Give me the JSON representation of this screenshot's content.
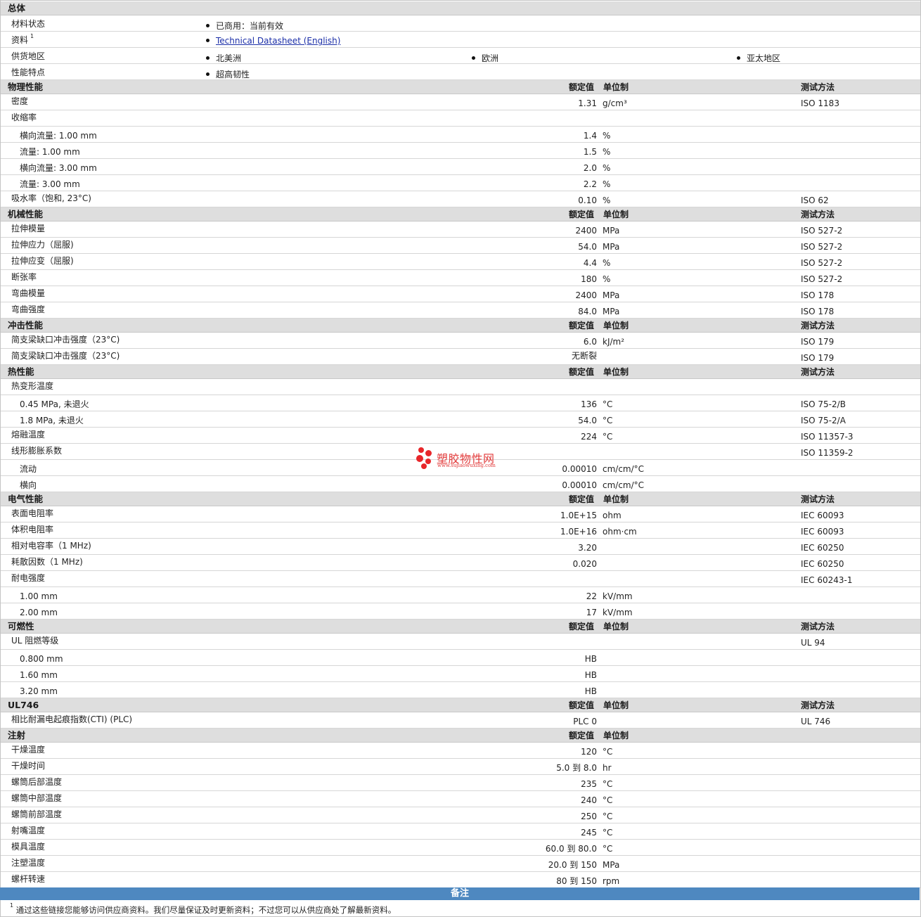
{
  "general": {
    "title": "总体",
    "rows": [
      {
        "label": "材料状态",
        "values": [
          "已商用：当前有效"
        ]
      },
      {
        "label": "资料",
        "sup": "1",
        "values": [
          "Technical Datasheet (English)"
        ],
        "link": true
      },
      {
        "label": "供货地区",
        "values": [
          "北美洲",
          "欧洲",
          "亚太地区"
        ]
      },
      {
        "label": "性能特点",
        "values": [
          "超高韧性"
        ]
      }
    ]
  },
  "col_headers": {
    "nominal": "额定值",
    "unit": "单位制",
    "method": "测试方法"
  },
  "sections": [
    {
      "title": "物理性能",
      "rows": [
        {
          "name": "密度",
          "value": "1.31",
          "unit": "g/cm³",
          "method": "ISO 1183"
        },
        {
          "name": "收缩率",
          "value": "",
          "unit": "",
          "method": ""
        },
        {
          "name": "横向流量: 1.00 mm",
          "value": "1.4",
          "unit": "%",
          "method": "",
          "sub": true
        },
        {
          "name": "流量: 1.00 mm",
          "value": "1.5",
          "unit": "%",
          "method": "",
          "sub": true
        },
        {
          "name": "横向流量: 3.00 mm",
          "value": "2.0",
          "unit": "%",
          "method": "",
          "sub": true
        },
        {
          "name": "流量: 3.00 mm",
          "value": "2.2",
          "unit": "%",
          "method": "",
          "sub": true
        },
        {
          "name": "吸水率（饱和, 23°C)",
          "value": "0.10",
          "unit": "%",
          "method": "ISO 62"
        }
      ]
    },
    {
      "title": "机械性能",
      "rows": [
        {
          "name": "拉伸模量",
          "value": "2400",
          "unit": "MPa",
          "method": "ISO 527-2"
        },
        {
          "name": "拉伸应力（屈服)",
          "value": "54.0",
          "unit": "MPa",
          "method": "ISO 527-2"
        },
        {
          "name": "拉伸应变（屈服)",
          "value": "4.4",
          "unit": "%",
          "method": "ISO 527-2"
        },
        {
          "name": "断张率",
          "value": "180",
          "unit": "%",
          "method": "ISO 527-2"
        },
        {
          "name": "弯曲模量",
          "value": "2400",
          "unit": "MPa",
          "method": "ISO 178"
        },
        {
          "name": "弯曲强度",
          "value": "84.0",
          "unit": "MPa",
          "method": "ISO 178"
        }
      ]
    },
    {
      "title": "冲击性能",
      "rows": [
        {
          "name": "简支梁缺口冲击强度（23°C)",
          "value": "6.0",
          "unit": "kJ/m²",
          "method": "ISO 179"
        },
        {
          "name": "简支梁缺口冲击强度（23°C)",
          "value": "无断裂",
          "unit": "",
          "method": "ISO 179"
        }
      ]
    },
    {
      "title": "热性能",
      "rows": [
        {
          "name": "热变形温度",
          "value": "",
          "unit": "",
          "method": ""
        },
        {
          "name": "0.45 MPa, 未退火",
          "value": "136",
          "unit": "°C",
          "method": "ISO 75-2/B",
          "sub": true
        },
        {
          "name": "1.8 MPa, 未退火",
          "value": "54.0",
          "unit": "°C",
          "method": "ISO 75-2/A",
          "sub": true
        },
        {
          "name": "熔融温度",
          "value": "224",
          "unit": "°C",
          "method": "ISO 11357-3"
        },
        {
          "name": "线形膨胀系数",
          "value": "",
          "unit": "",
          "method": "ISO 11359-2"
        },
        {
          "name": "流动",
          "value": "0.00010",
          "unit": "cm/cm/°C",
          "method": "",
          "sub": true
        },
        {
          "name": "横向",
          "value": "0.00010",
          "unit": "cm/cm/°C",
          "method": "",
          "sub": true
        }
      ]
    },
    {
      "title": "电气性能",
      "rows": [
        {
          "name": "表面电阻率",
          "value": "1.0E+15",
          "unit": "ohm",
          "method": "IEC 60093"
        },
        {
          "name": "体积电阻率",
          "value": "1.0E+16",
          "unit": "ohm·cm",
          "method": "IEC 60093"
        },
        {
          "name": "相对电容率（1 MHz)",
          "value": "3.20",
          "unit": "",
          "method": "IEC 60250"
        },
        {
          "name": "耗散因数（1 MHz)",
          "value": "0.020",
          "unit": "",
          "method": "IEC 60250"
        },
        {
          "name": "耐电强度",
          "value": "",
          "unit": "",
          "method": "IEC 60243-1"
        },
        {
          "name": "1.00 mm",
          "value": "22",
          "unit": "kV/mm",
          "method": "",
          "sub": true
        },
        {
          "name": "2.00 mm",
          "value": "17",
          "unit": "kV/mm",
          "method": "",
          "sub": true
        }
      ]
    },
    {
      "title": "可燃性",
      "rows": [
        {
          "name": "UL 阻燃等级",
          "value": "",
          "unit": "",
          "method": "UL 94"
        },
        {
          "name": "0.800 mm",
          "value": "HB",
          "unit": "",
          "method": "",
          "sub": true
        },
        {
          "name": "1.60 mm",
          "value": "HB",
          "unit": "",
          "method": "",
          "sub": true
        },
        {
          "name": "3.20 mm",
          "value": "HB",
          "unit": "",
          "method": "",
          "sub": true
        }
      ]
    },
    {
      "title": "UL746",
      "rows": [
        {
          "name": "相比耐漏电起痕指数(CTI) (PLC)",
          "value": "PLC 0",
          "unit": "",
          "method": "UL 746"
        }
      ]
    },
    {
      "title": "注射",
      "no_method": true,
      "rows": [
        {
          "name": "干燥温度",
          "value": "120",
          "unit": "°C",
          "method": ""
        },
        {
          "name": "干燥时间",
          "value": "5.0 到  8.0",
          "unit": "hr",
          "method": ""
        },
        {
          "name": "螺筒后部温度",
          "value": "235",
          "unit": "°C",
          "method": ""
        },
        {
          "name": "螺筒中部温度",
          "value": "240",
          "unit": "°C",
          "method": ""
        },
        {
          "name": "螺筒前部温度",
          "value": "250",
          "unit": "°C",
          "method": ""
        },
        {
          "name": "射嘴温度",
          "value": "245",
          "unit": "°C",
          "method": ""
        },
        {
          "name": "模具温度",
          "value": "60.0 到  80.0",
          "unit": "°C",
          "method": ""
        },
        {
          "name": "注塑温度",
          "value": "20.0 到  150",
          "unit": "MPa",
          "method": ""
        },
        {
          "name": "螺杆转速",
          "value": "80 到  150",
          "unit": "rpm",
          "method": ""
        }
      ]
    }
  ],
  "notes": {
    "title": "备注",
    "sup": "1",
    "text": "通过这些链接您能够访问供应商资料。我们尽量保证及时更新资料；不过您可以从供应商处了解最新资料。"
  },
  "watermark": {
    "title": "塑胶物性网",
    "url": "www.sujiaowuxing.com",
    "color": "#e8262a"
  }
}
